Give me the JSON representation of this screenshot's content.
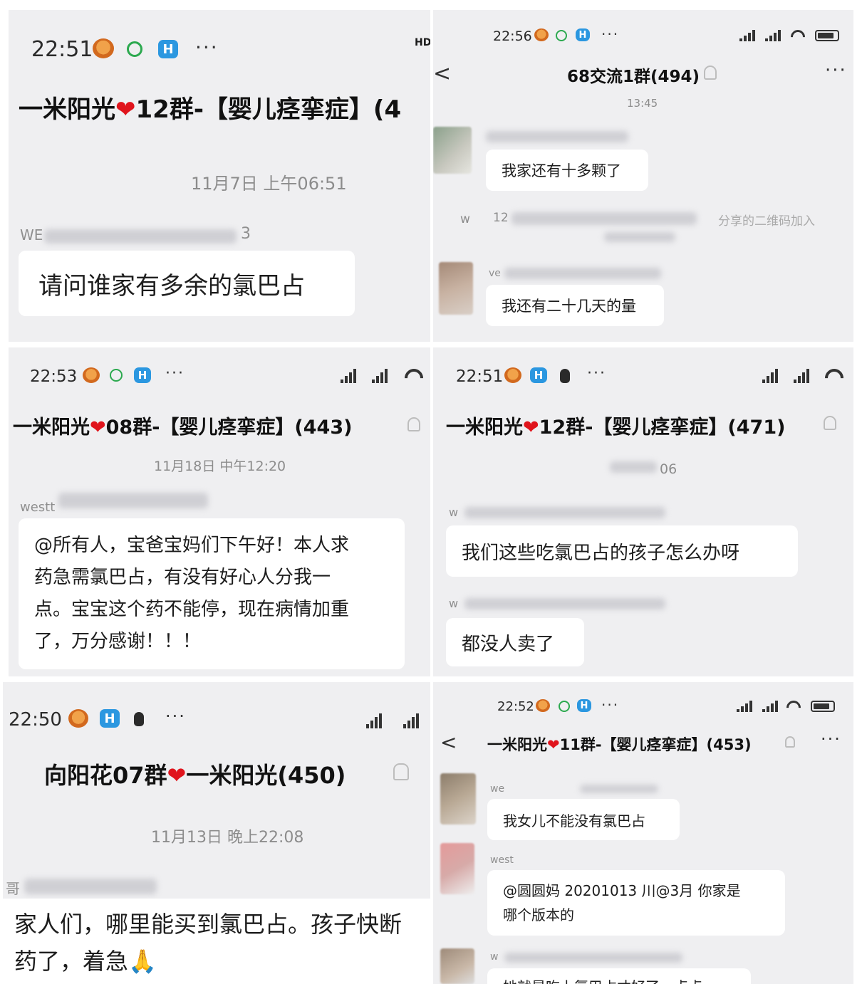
{
  "p1": {
    "time": "22:51",
    "title_before": "一米阳光",
    "heart": "❤",
    "title_after": "12群-【婴儿痉挛症】(4",
    "hd": "HD",
    "date": "11月7日 上午06:51",
    "sender": "WE",
    "sender_tail": "3",
    "message": "请问谁家有多余的氯巴占"
  },
  "p2": {
    "time": "22:56",
    "back": "<",
    "title": "68交流1群(494)",
    "time_divider": "13:45",
    "message1": "我家还有十多颗了",
    "system_left": "w",
    "system_num": "12",
    "system_text": "分享的二维码加入",
    "sender2": "ve",
    "message2": "我还有二十几天的量"
  },
  "p3": {
    "time": "22:53",
    "title_before": "一米阳光",
    "heart": "❤",
    "title_after": "08群-【婴儿痉挛症】(443)",
    "date": "11月18日 中午12:20",
    "sender": "westt",
    "message_lines": [
      "@所有人，宝爸宝妈们下午好！本人求",
      "药急需氯巴占，有没有好心人分我一",
      "点。宝宝这个药不能停，现在病情加重",
      "了，万分感谢！！！"
    ]
  },
  "p4": {
    "time": "22:51",
    "title_before": "一米阳光",
    "heart": "❤",
    "title_after": "12群-【婴儿痉挛症】(471)",
    "date": "06",
    "sender1": "w",
    "message1": "我们这些吃氯巴占的孩子怎么办呀",
    "sender2": "w",
    "message2": "都没人卖了"
  },
  "p5": {
    "time": "22:50",
    "title_before": "向阳花07群",
    "heart": "❤",
    "title_after": "一米阳光(450)",
    "date": "11月13日 晚上22:08",
    "sender": "哥",
    "message_lines": [
      "家人们，哪里能买到氯巴占。孩子快断",
      "药了，着急🙏"
    ]
  },
  "p6": {
    "time": "22:52",
    "back": "<",
    "title_before": "一米阳光",
    "heart": "❤",
    "title_after": "11群-【婴儿痉挛症】(453)",
    "sender1": "we",
    "message1": "我女儿不能没有氯巴占",
    "sender2": "west",
    "message2_lines": [
      "@圆圆妈 20201013 川@3月  你家是",
      "哪个版本的"
    ],
    "sender3": "w",
    "message3": "她就是吃上氯巴占才好了一点点"
  },
  "common": {
    "dots": "···",
    "icon_letter": "H"
  }
}
